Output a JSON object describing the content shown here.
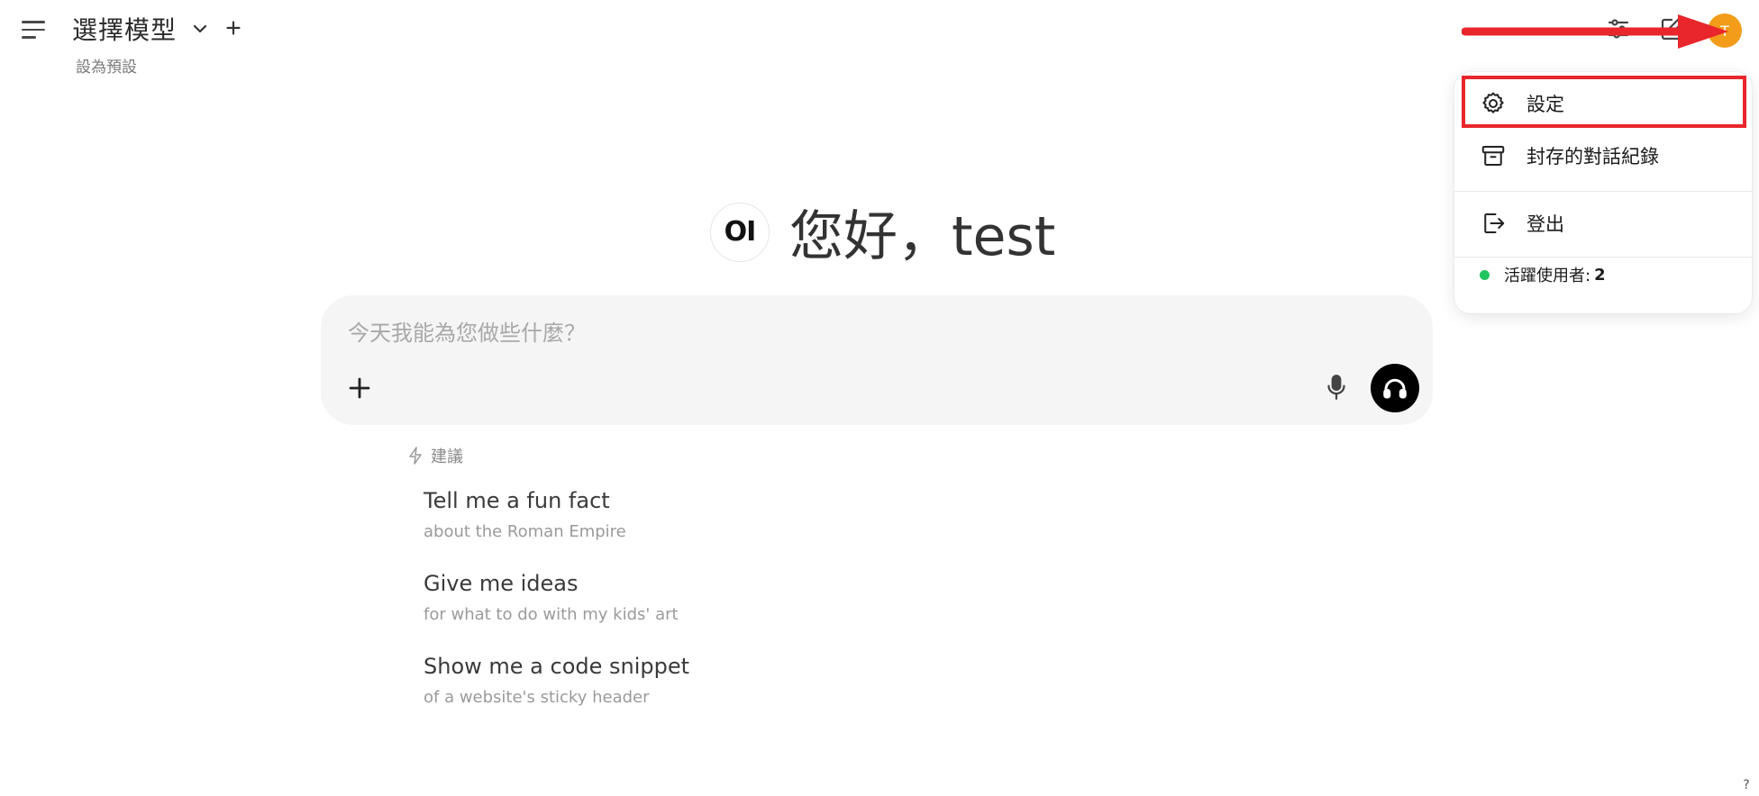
{
  "header": {
    "model_selector_label": "選擇模型",
    "set_default_label": "設為預設",
    "avatar_initial": "T"
  },
  "user_menu": {
    "settings_label": "設定",
    "archived_chats_label": "封存的對話紀錄",
    "sign_out_label": "登出",
    "active_users_label": "活躍使用者:",
    "active_users_count": "2"
  },
  "greeting": {
    "logo_text": "OI",
    "text": "您好，test"
  },
  "chat": {
    "placeholder": "今天我能為您做些什麼？"
  },
  "suggestions": {
    "label": "建議",
    "items": [
      {
        "title": "Tell me a fun fact",
        "subtitle": "about the Roman Empire"
      },
      {
        "title": "Give me ideas",
        "subtitle": "for what to do with my kids' art"
      },
      {
        "title": "Show me a code snippet",
        "subtitle": "of a website's sticky header"
      }
    ]
  },
  "help": {
    "label": "?"
  },
  "colors": {
    "avatar": "#f29c1a",
    "annotation_red": "#e8262b",
    "active_dot": "#22c55e",
    "chat_box_bg": "#f5f5f5"
  }
}
